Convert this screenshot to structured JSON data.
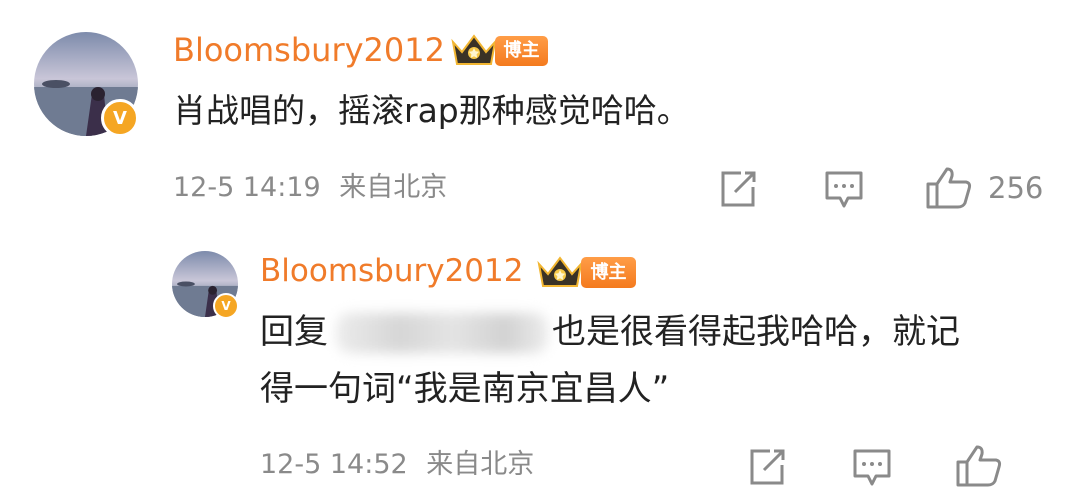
{
  "comment": {
    "username": "Bloomsbury2012",
    "badge_label": "博主",
    "verified_mark": "V",
    "text": "肖战唱的，摇滚rap那种感觉哈哈。",
    "time": "12-5 14:19",
    "location": "来自北京",
    "like_count": "256",
    "icons": [
      "share-icon",
      "comment-icon",
      "like-icon"
    ]
  },
  "reply": {
    "username": "Bloomsbury2012",
    "badge_label": "博主",
    "verified_mark": "V",
    "reply_prefix": "回复",
    "text_line1": "也是很看得起我哈哈，就记",
    "text_line2": "得一句词“我是南京宜昌人”",
    "time": "12-5 14:52",
    "location": "来自北京",
    "icons": [
      "share-icon",
      "comment-icon",
      "like-icon"
    ]
  },
  "colors": {
    "username": "#f07b2a",
    "badge": "#f47a1e",
    "verified": "#f5a623",
    "meta": "#8a8a8a"
  }
}
